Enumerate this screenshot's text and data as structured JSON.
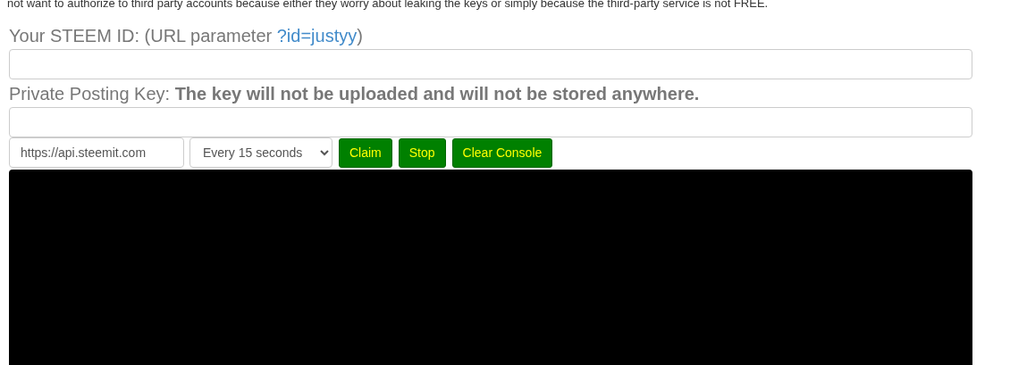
{
  "intro": "not want to authorize to third party accounts because either they worry about leaking the keys or simply because the third-party service is not FREE.",
  "id_label": {
    "text": "Your STEEM ID: (URL parameter ",
    "link": "?id=justyy",
    "after": ")"
  },
  "key_label": "Private Posting Key: **The key will not be uploaded and will not be stored anywhere.**",
  "node_field": {
    "value": "https://api.steemit.com"
  },
  "interval_select": {
    "value": "Every 15 seconds"
  },
  "buttons": [
    {
      "label": "Claim"
    },
    {
      "label": "Stop"
    },
    {
      "label": "Clear Console"
    }
  ]
}
